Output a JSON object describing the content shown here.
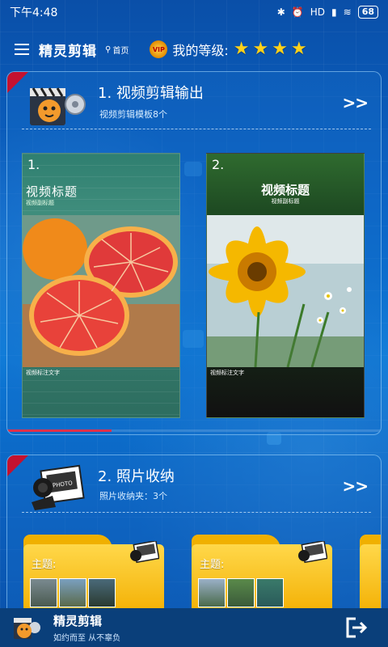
{
  "status_bar": {
    "time": "下午4:48",
    "network": "HD",
    "battery": "68"
  },
  "header": {
    "title": "精灵剪辑",
    "home_label": "首页",
    "level_label": "我的等级:",
    "vip_badge": "VIP",
    "star_count": 4
  },
  "video_card": {
    "title": "1. 视频剪辑输出",
    "subtitle": "视频剪辑模板8个",
    "arrow": ">>",
    "templates": [
      {
        "number": "1.",
        "title": "视频标题",
        "subtitle": "视频副标题",
        "caption": "视频标注文字"
      },
      {
        "number": "2.",
        "title": "视频标题",
        "subtitle": "视频副标题",
        "caption": "视频标注文字"
      }
    ],
    "scroll_progress": 0.28
  },
  "photo_card": {
    "title": "2. 照片收纳",
    "subtitle": "照片收纳夹：3个",
    "arrow": ">>",
    "icon_text": "PHOTO",
    "folders": [
      {
        "label": "主题:"
      },
      {
        "label": "主题:"
      }
    ]
  },
  "bottom_bar": {
    "title": "精灵剪辑",
    "slogan": "如约而至  从不辜负"
  },
  "colors": {
    "accent_red": "#c4122f",
    "star": "#ffd11a",
    "folder": "#f3ae00"
  }
}
